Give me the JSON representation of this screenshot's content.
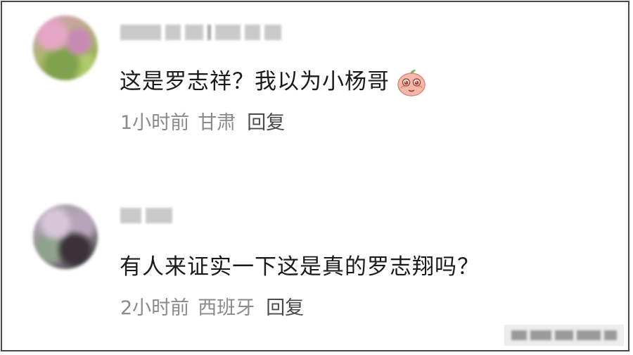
{
  "comments": [
    {
      "text": "这是罗志祥？我以为小杨哥",
      "time": "1小时前",
      "location": "甘肃",
      "reply_label": "回复",
      "emoji": "pleading-peach-emoji"
    },
    {
      "text": "有人来证实一下这是真的罗志翔吗？",
      "time": "2小时前",
      "location": "西班牙",
      "reply_label": "回复"
    }
  ],
  "colors": {
    "text": "#1a1a1a",
    "meta": "#8a8a8a",
    "border": "#4a4a4a"
  }
}
